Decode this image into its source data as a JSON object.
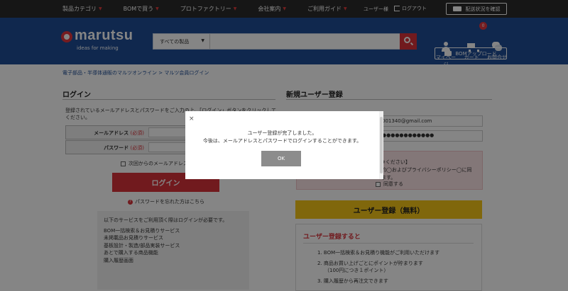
{
  "topbar": {
    "nav": [
      {
        "label": "製品カテゴリ"
      },
      {
        "label": "BOMで買う"
      },
      {
        "label": "プロトファクトリー"
      },
      {
        "label": "会社案内"
      },
      {
        "label": "ご利用ガイド"
      }
    ],
    "user": "ユーザー様",
    "logout": "ログアウト",
    "delivery": "配送状況を確認"
  },
  "header": {
    "logo_text": "marutsu",
    "logo_tagline": "ideas for making",
    "search_category": "すべての製品",
    "search_value": "",
    "mypage": "マイページ",
    "cart": "カート",
    "cart_count": "0",
    "contact": "お問合せ",
    "bom_upload": "BOMアップロード"
  },
  "breadcrumb": "電子部品・半導体通販のマルツオンライン > マルツ会員ログイン",
  "login": {
    "title": "ログイン",
    "description": "登録されているメールアドレスとパスワードをご入力の上、「ログイン」ボタンをクリックしてください。",
    "email_label": "メールアドレス",
    "password_label": "パスワード",
    "required": "(必須)",
    "email_value": "",
    "password_value": "",
    "remember": "次回からのメールアドレス",
    "button": "ログイン",
    "forgot": "パスワードを忘れた方はこちら",
    "services_intro": "以下のサービスをご利用頂く際はログインが必要です。",
    "services": [
      "BOM一括検索＆お見積りサービス",
      "未掲載品お見積りサービス",
      "基板設計・製造/部品実装サービス",
      "あとで購入する商品機能",
      "購入履歴画面"
    ]
  },
  "register": {
    "title": "新規ユーザー登録",
    "email_value": "001340@gmail.com",
    "password_value": "●●●●●●●●●●●●",
    "pink_lines": [
      "※ください】",
      "約◯およびプライバシーポリシー◯に同",
      "ます。"
    ],
    "agree": "同意する",
    "button": "ユーザー登録（無料）",
    "benefits_title": "ユーザー登録すると",
    "benefits": [
      "1. BOM一括検索＆お見積り機能がご利用いただけます",
      "2. 商品お買い上げごとにポイントが貯まります",
      "（100円につき１ポイント）",
      "3. 購入履歴から再注文できます"
    ]
  },
  "modal": {
    "close": "×",
    "line1": "ユーザー登録が完了しました。",
    "line2": "今後は、メールアドレスとパスワードでログインすることができます。",
    "ok": "OK"
  },
  "colors": {
    "header_blue": "#1f4e96",
    "accent_red": "#d8323a",
    "register_yellow": "#f5c518",
    "topbar_dark": "#2b2b2b"
  }
}
